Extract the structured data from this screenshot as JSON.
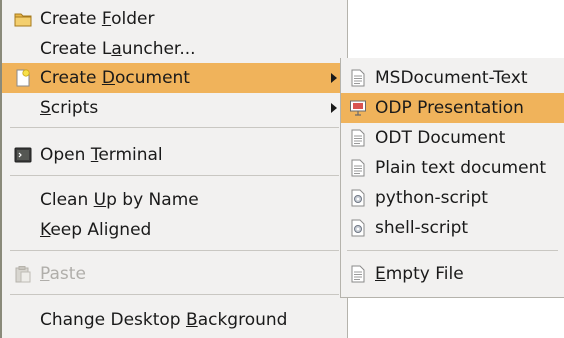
{
  "main_menu": {
    "items": [
      {
        "pre": "Create ",
        "mn": "F",
        "post": "older"
      },
      {
        "pre": "Create L",
        "mn": "a",
        "post": "uncher..."
      },
      {
        "pre": "Create ",
        "mn": "D",
        "post": "ocument"
      },
      {
        "pre": "",
        "mn": "S",
        "post": "cripts"
      },
      {
        "pre": "Open ",
        "mn": "T",
        "post": "erminal"
      },
      {
        "pre": "Clean ",
        "mn": "U",
        "post": "p by Name"
      },
      {
        "pre": "",
        "mn": "K",
        "post": "eep Aligned"
      },
      {
        "pre": "",
        "mn": "P",
        "post": "aste"
      },
      {
        "pre": "Change Desktop ",
        "mn": "B",
        "post": "ackground"
      }
    ]
  },
  "sub_menu": {
    "items": [
      {
        "pre": "MSDocument-Text",
        "mn": "",
        "post": ""
      },
      {
        "pre": "ODP Presentation",
        "mn": "",
        "post": ""
      },
      {
        "pre": "ODT Document",
        "mn": "",
        "post": ""
      },
      {
        "pre": "Plain text document",
        "mn": "",
        "post": ""
      },
      {
        "pre": "python-script",
        "mn": "",
        "post": ""
      },
      {
        "pre": "shell-script",
        "mn": "",
        "post": ""
      },
      {
        "pre": "",
        "mn": "E",
        "post": "mpty File"
      }
    ]
  },
  "icons": {
    "folder": "folder-icon",
    "new_document": "new-document-icon",
    "terminal": "terminal-icon",
    "paste": "paste-icon",
    "text_document": "text-document-icon",
    "presentation": "presentation-icon",
    "script": "script-icon"
  },
  "colors": {
    "highlight": "#f0b35b",
    "menu_background": "#f2f1f0",
    "disabled_text": "#b0aeaa"
  }
}
